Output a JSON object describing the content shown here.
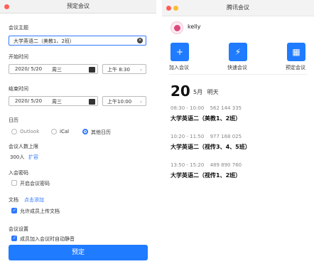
{
  "colors": {
    "accent": "#2f78ff",
    "primary_button": "#1f7bff",
    "close": "#ff5f57",
    "minimize": "#febc2e",
    "zoom": "#28c840"
  },
  "left_window": {
    "title": "预定会议",
    "topic": {
      "label": "会议主题",
      "value": "大学英语二（美教1、2班）"
    },
    "start": {
      "label": "开始时间",
      "date": "2020/ 5/20",
      "weekday": "周三",
      "time": "上午 8:30"
    },
    "end": {
      "label": "结束时间",
      "date": "2020/ 5/20",
      "weekday": "周三",
      "time": "上午10:00"
    },
    "calendar": {
      "label": "日历",
      "options": [
        {
          "label": "Outlook",
          "selected": false
        },
        {
          "label": "iCal",
          "selected": false
        },
        {
          "label": "其他日历",
          "selected": true
        }
      ]
    },
    "attendee_limit": {
      "label": "会议人数上限",
      "value": "300人",
      "link": "扩容"
    },
    "password": {
      "label": "入会密码",
      "checkbox_label": "开启会议密码",
      "checked": false
    },
    "docs": {
      "label": "文档",
      "link": "点击添加",
      "checkbox_label": "允许成员上传文档",
      "checked": true
    },
    "settings": {
      "label": "会议设置",
      "checkbox_label": "成员加入会议时自动静音",
      "checked": true
    },
    "submit_label": "预定"
  },
  "right_window": {
    "title": "腾讯会议",
    "user": {
      "name": "kelly"
    },
    "actions": [
      {
        "label": "加入会议",
        "icon": "plus-icon",
        "glyph": "+"
      },
      {
        "label": "快速会议",
        "icon": "lightning-icon",
        "glyph": "⚡"
      },
      {
        "label": "预定会议",
        "icon": "calendar-icon",
        "glyph": "▦"
      }
    ],
    "date": {
      "day": "20",
      "month": "5月",
      "rel": "明天"
    },
    "meetings": [
      {
        "time": "08:30 - 10:00",
        "id": "562 144 335",
        "title": "大学英语二（美教1、2班）"
      },
      {
        "time": "10:20 - 11:50",
        "id": "977 168 025",
        "title": "大学英语二（视传3、4、5班）"
      },
      {
        "time": "13:50 - 15:20",
        "id": "489 890 760",
        "title": "大学英语二（视传1、2班）"
      }
    ]
  }
}
